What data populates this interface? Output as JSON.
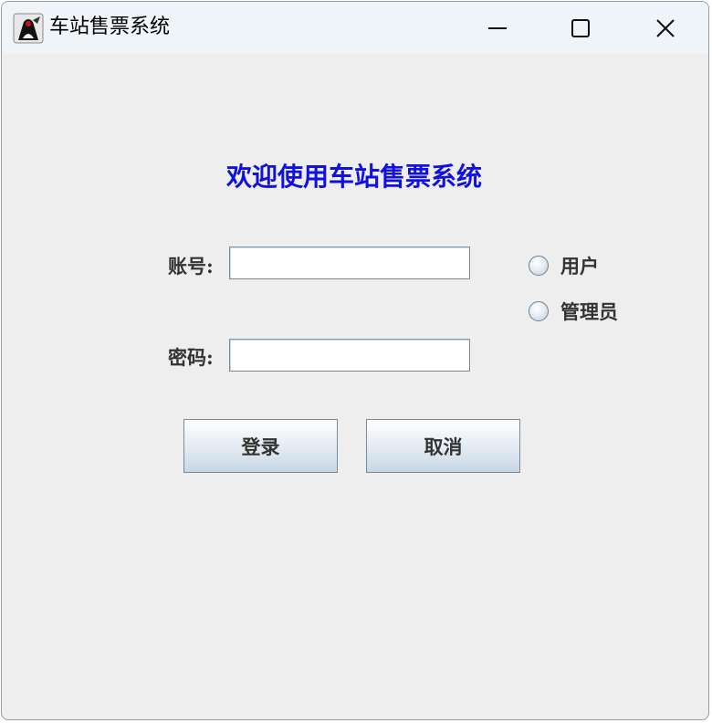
{
  "window": {
    "title": "车站售票系统",
    "icon": "java-duke-icon"
  },
  "titlebar_controls": {
    "minimize": "minimize-icon",
    "maximize": "maximize-icon",
    "close": "close-icon"
  },
  "main": {
    "welcome_text": "欢迎使用车站售票系统",
    "welcome_color": "#1010e0",
    "account_label": "账号:",
    "account_value": "",
    "password_label": "密码:",
    "password_value": "",
    "roles": [
      {
        "label": "用户",
        "selected": false
      },
      {
        "label": "管理员",
        "selected": false
      }
    ],
    "login_button": "登录",
    "cancel_button": "取消"
  }
}
